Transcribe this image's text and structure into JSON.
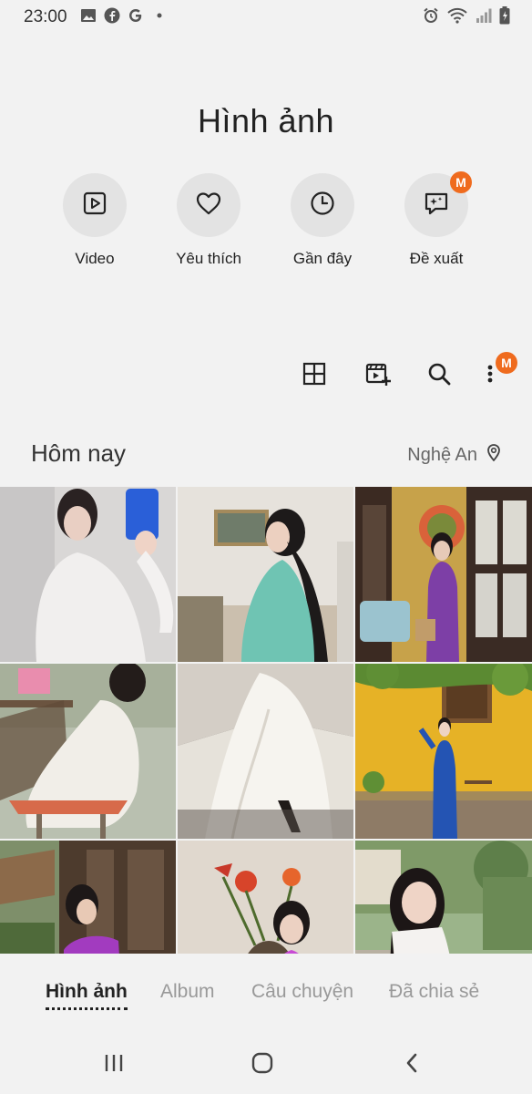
{
  "status_bar": {
    "time": "23:00",
    "left_icons": [
      "gallery-icon",
      "facebook-icon",
      "google-icon",
      "dot-icon"
    ],
    "right_icons": [
      "alarm-icon",
      "wifi-icon",
      "signal-icon",
      "battery-icon"
    ]
  },
  "header": {
    "title": "Hình ảnh"
  },
  "quick_actions": [
    {
      "label": "Video",
      "icon": "video-icon"
    },
    {
      "label": "Yêu thích",
      "icon": "heart-icon"
    },
    {
      "label": "Gần đây",
      "icon": "clock-icon"
    },
    {
      "label": "Đề xuất",
      "icon": "sparkle-chat-icon",
      "badge": "M"
    }
  ],
  "toolbar": {
    "icons": [
      "grid-view-icon",
      "create-video-icon",
      "search-icon",
      "more-icon"
    ],
    "more_badge": "M"
  },
  "section": {
    "title": "Hôm nay",
    "location": "Nghệ An"
  },
  "photos": [
    "photo-white-ao-dai-selfie",
    "photo-teal-ao-dai-seated",
    "photo-purple-ao-dai-door",
    "photo-white-ao-dai-classroom",
    "photo-white-ao-dai-closeup",
    "photo-blue-ao-dai-yellow-wall",
    "photo-purple-ao-dai-wooden-house",
    "photo-purple-ao-dai-flowers",
    "photo-white-ao-dai-park"
  ],
  "tabs": [
    {
      "label": "Hình ảnh",
      "active": true
    },
    {
      "label": "Album",
      "active": false
    },
    {
      "label": "Câu chuyện",
      "active": false
    },
    {
      "label": "Đã chia sẻ",
      "active": false
    }
  ],
  "nav": [
    "recents-icon",
    "home-icon",
    "back-icon"
  ],
  "colors": {
    "badge": "#ef6b1e",
    "background": "#f2f2f2",
    "circle": "#e3e3e3"
  }
}
